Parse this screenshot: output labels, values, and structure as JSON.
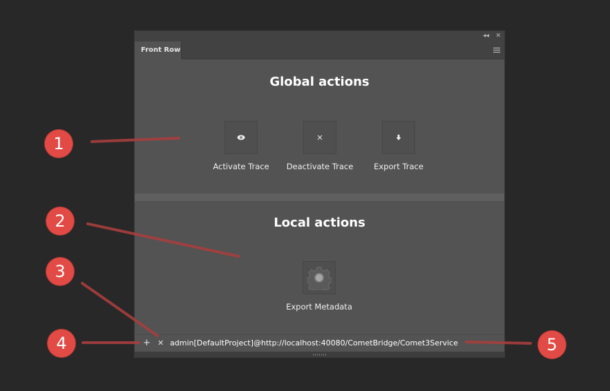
{
  "panel": {
    "tab_label": "Front Row",
    "titlebar": {
      "collapse_glyph": "◂◂",
      "close_glyph": "✕"
    },
    "menu_icon": "hamburger-menu-icon"
  },
  "global_section": {
    "heading": "Global actions",
    "actions": [
      {
        "label": "Activate Trace",
        "icon": "eye-icon"
      },
      {
        "label": "Deactivate Trace",
        "icon": "x-icon"
      },
      {
        "label": "Export Trace",
        "icon": "download-arrow-icon"
      }
    ]
  },
  "local_section": {
    "heading": "Local actions",
    "actions": [
      {
        "label": "Export Metadata",
        "icon": "gear-icon"
      }
    ]
  },
  "statusbar": {
    "add_glyph": "+",
    "remove_glyph": "✕",
    "connection": "admin[DefaultProject]@http://localhost:40080/CometBridge/Comet3Service"
  },
  "callouts": [
    "1",
    "2",
    "3",
    "4",
    "5"
  ],
  "colors": {
    "callout": "#e24a45",
    "callout_line": "#a83e3e",
    "panel_bg": "#535353",
    "page_bg": "#282828"
  }
}
